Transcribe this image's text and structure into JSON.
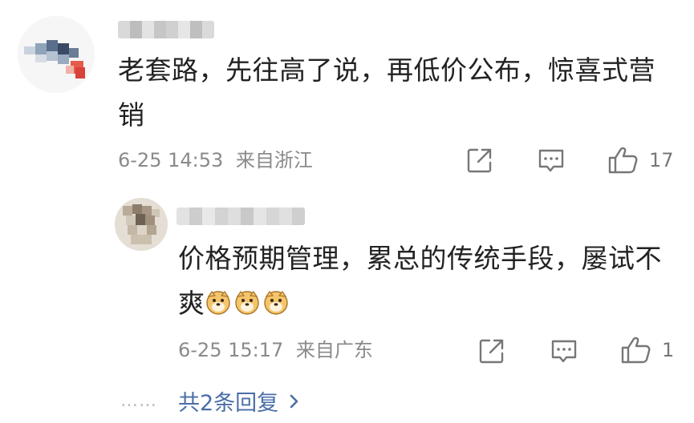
{
  "comment": {
    "text": "老套路，先往高了说，再低价公布，惊喜式营销",
    "time": "6-25 14:53",
    "location": "来自浙江",
    "like_count": "17"
  },
  "reply": {
    "text": "价格预期管理，累总的传统手段，屡试不爽",
    "time": "6-25 15:17",
    "location": "来自广东",
    "like_count": "1",
    "emoji_name": "doge"
  },
  "more_replies": {
    "dots": "……",
    "label": "共2条回复",
    "chevron": "›"
  },
  "icons": {
    "share": "share-icon",
    "reply": "comment-icon",
    "like": "thumbs-up-icon",
    "expand": "chevron-right-icon"
  },
  "colors": {
    "text": "#222222",
    "meta": "#8a8a8a",
    "link": "#4a6ea8",
    "icon": "#777777"
  }
}
